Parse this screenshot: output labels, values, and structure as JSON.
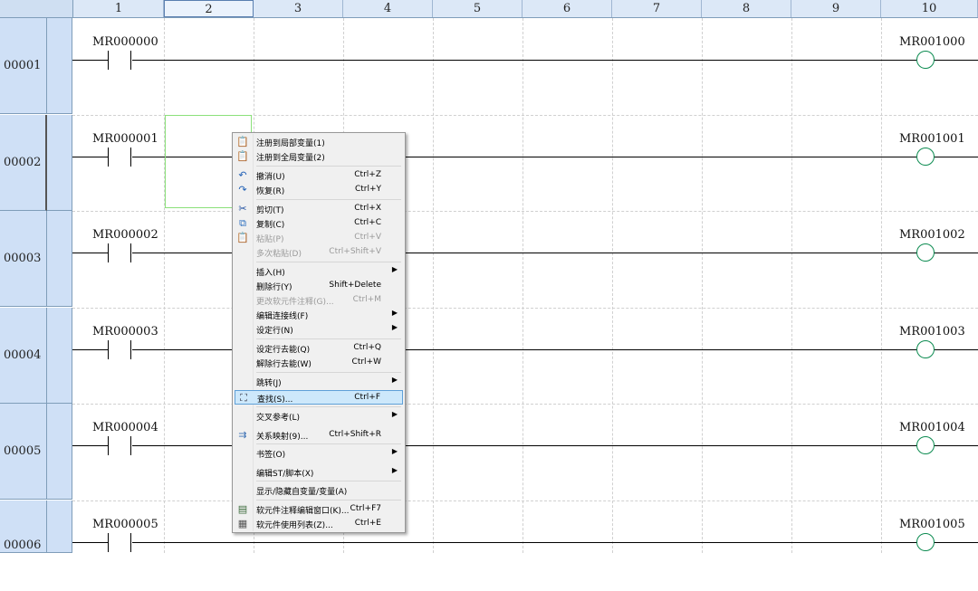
{
  "columns": [
    "1",
    "2",
    "3",
    "4",
    "5",
    "6",
    "7",
    "8",
    "9",
    "10"
  ],
  "selected_column": "2",
  "rows": [
    {
      "number": "00001",
      "contact": "MR000000",
      "coil": "MR001000"
    },
    {
      "number": "00002",
      "contact": "MR000001",
      "coil": "MR001001"
    },
    {
      "number": "00003",
      "contact": "MR000002",
      "coil": "MR001002"
    },
    {
      "number": "00004",
      "contact": "MR000003",
      "coil": "MR001003"
    },
    {
      "number": "00005",
      "contact": "MR000004",
      "coil": "MR001004"
    },
    {
      "number": "00006",
      "contact": "MR000005",
      "coil": "MR001005"
    }
  ],
  "context_menu": {
    "items": [
      {
        "label": "注册到局部变量(1)",
        "shortcut": "",
        "icon": "register-local-icon"
      },
      {
        "label": "注册到全局变量(2)",
        "shortcut": "",
        "icon": "register-global-icon"
      },
      {
        "label": "撤消(U)",
        "shortcut": "Ctrl+Z",
        "icon": "undo-icon"
      },
      {
        "label": "恢复(R)",
        "shortcut": "Ctrl+Y",
        "icon": "redo-icon"
      },
      {
        "label": "剪切(T)",
        "shortcut": "Ctrl+X",
        "icon": "cut-icon"
      },
      {
        "label": "复制(C)",
        "shortcut": "Ctrl+C",
        "icon": "copy-icon"
      },
      {
        "label": "粘贴(P)",
        "shortcut": "Ctrl+V",
        "icon": "paste-icon",
        "disabled": true
      },
      {
        "label": "多次粘贴(D)",
        "shortcut": "Ctrl+Shift+V",
        "disabled": true
      },
      {
        "label": "插入(H)",
        "shortcut": "",
        "submenu": true
      },
      {
        "label": "删除行(Y)",
        "shortcut": "Shift+Delete"
      },
      {
        "label": "更改软元件注释(G)...",
        "shortcut": "Ctrl+M",
        "disabled": true
      },
      {
        "label": "编辑连接线(F)",
        "shortcut": "",
        "submenu": true
      },
      {
        "label": "设定行(N)",
        "shortcut": "",
        "submenu": true
      },
      {
        "label": "设定行去能(Q)",
        "shortcut": "Ctrl+Q"
      },
      {
        "label": "解除行去能(W)",
        "shortcut": "Ctrl+W"
      },
      {
        "label": "跳转(J)",
        "shortcut": "",
        "submenu": true
      },
      {
        "label": "查找(S)...",
        "shortcut": "Ctrl+F",
        "icon": "binoculars-icon",
        "highlighted": true
      },
      {
        "label": "交叉参考(L)",
        "shortcut": "",
        "submenu": true
      },
      {
        "label": "关系映射(9)...",
        "shortcut": "Ctrl+Shift+R",
        "icon": "relation-map-icon"
      },
      {
        "label": "书签(O)",
        "shortcut": "",
        "submenu": true
      },
      {
        "label": "编辑ST/脚本(X)",
        "shortcut": "",
        "submenu": true
      },
      {
        "label": "显示/隐藏自变量/变量(A)",
        "shortcut": ""
      },
      {
        "label": "软元件注释编辑窗口(K)...",
        "shortcut": "Ctrl+F7",
        "icon": "comment-window-icon"
      },
      {
        "label": "软元件使用列表(Z)...",
        "shortcut": "Ctrl+E",
        "icon": "usage-list-icon"
      }
    ]
  },
  "colors": {
    "coil": "#0a8a4f",
    "header_bg": "#dce8f7",
    "row_header_bg": "#cfe0f6",
    "menu_highlight": "#cde8fb"
  }
}
